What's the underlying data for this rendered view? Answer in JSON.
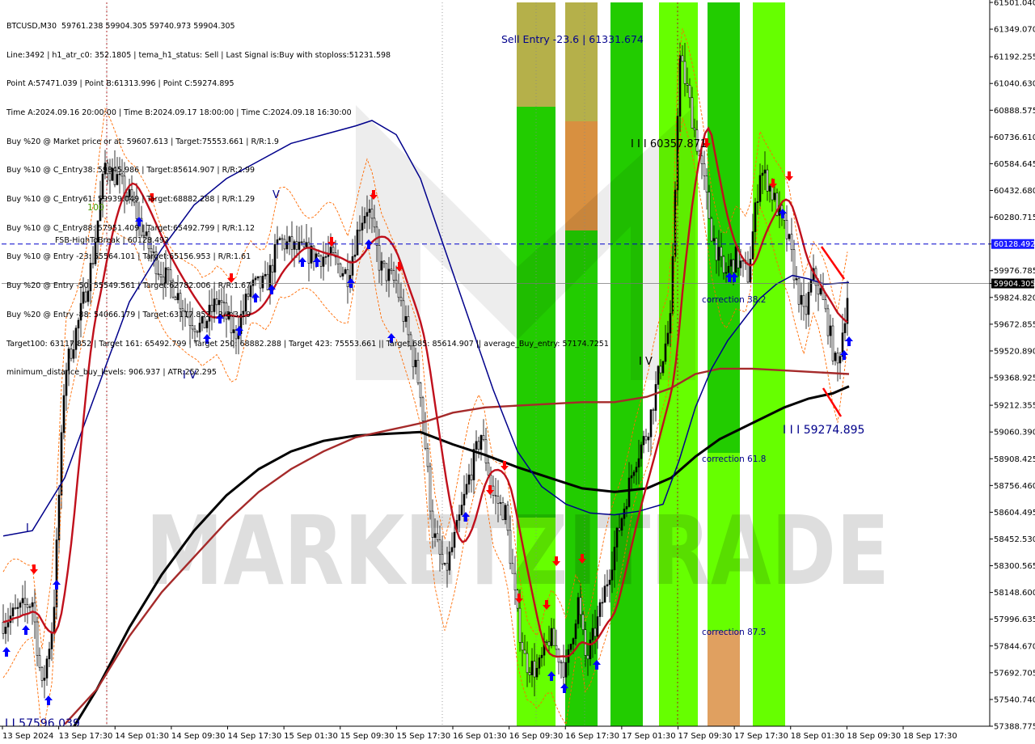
{
  "header": {
    "lines": [
      "BTCUSD,M30  59761.238 59904.305 59740.973 59904.305",
      "Line:3492 | h1_atr_c0: 352.1805 | tema_h1_status: Sell | Last Signal is:Buy with stoploss:51231.598",
      "Point A:57471.039 | Point B:61313.996 | Point C:59274.895",
      "Time A:2024.09.16 20:00:00 | Time B:2024.09.17 18:00:00 | Time C:2024.09.18 16:30:00",
      "Buy %20 @ Market price or at: 59607.613 | Target:75553.661 | R/R:1.9",
      "Buy %10 @ C_Entry38: 59845.986 | Target:85614.907 | R/R:2.99",
      "Buy %10 @ C_Entry61: 59939.049 | Target:68882.288 | R/R:1.29",
      "Buy %10 @ C_Entry88: 57951.409 | Target:65492.799 | R/R:1.12",
      "Buy %10 @ Entry -23: 55564.101 | Target:65156.953 | R/R:1.61",
      "Buy %20 @ Entry -50: 55549.561 | Target:62782.006 | R/R:1.67",
      "Buy %20 @ Entry -88: 54066.179 | Target:63117.852 | R/R:3.19",
      "Target100: 63117.852 | Target 161: 65492.799 | Target 250: 68882.288 | Target 423: 75553.661 || Target 685: 85614.907 || average_Buy_entry: 57174.7251",
      "minimum_distance_buy_levels: 906.937 | ATR:252.295"
    ]
  },
  "labels": {
    "sell_entry": "Sell Entry -23.6 | 61331.674",
    "point_b": "I I I 60357.871",
    "point_c": "I I I 59274.895",
    "point_a": "I I 57596.039",
    "fsb": "FSB-HighToBreak | 60128.492",
    "corr38": "correction 38.2",
    "corr61": "correction 61.8",
    "corr87": "correction 87.5",
    "wave_v": "V",
    "wave_iv1": "I V",
    "wave_iv2": "I V",
    "wave_i": "I",
    "hundred": "100",
    "watermark": "MARKETZITRADE"
  },
  "price_boxes": {
    "fsb_price": "60128.492",
    "current_price": "59904.305"
  },
  "colors": {
    "navy_ma": "#00008b",
    "red_ma": "#c0101c",
    "darkred_ma": "#a52a2a",
    "black_ma": "#000000",
    "green_zone": "#22cc00",
    "lime_zone": "#66ff00",
    "olive_zone": "#b5b04a",
    "orange_zone": "#e0a060",
    "buy_arrow": "#0000ff",
    "sell_arrow": "#ff0000",
    "fsb_line": "#0000cc"
  },
  "chart_data": {
    "type": "candlestick",
    "symbol": "BTCUSD",
    "timeframe": "M30",
    "ylim": [
      57388.775,
      61501.04
    ],
    "y_ticks": [
      "61501.040",
      "61349.070",
      "61192.255",
      "61040.630",
      "60888.575",
      "60736.610",
      "60584.645",
      "60432.680",
      "60280.715",
      "60128.492",
      "59976.785",
      "59904.305",
      "59824.820",
      "59672.855",
      "59520.890",
      "59368.925",
      "59212.355",
      "59060.390",
      "58908.425",
      "58756.460",
      "58604.495",
      "58452.530",
      "58300.565",
      "58148.600",
      "57996.635",
      "57844.670",
      "57692.705",
      "57540.740",
      "57388.775"
    ],
    "x_ticks": [
      "13 Sep 2024",
      "13 Sep 17:30",
      "14 Sep 01:30",
      "14 Sep 09:30",
      "14 Sep 17:30",
      "15 Sep 01:30",
      "15 Sep 09:30",
      "15 Sep 17:30",
      "16 Sep 01:30",
      "16 Sep 09:30",
      "16 Sep 17:30",
      "17 Sep 01:30",
      "17 Sep 09:30",
      "17 Sep 17:30",
      "18 Sep 01:30",
      "18 Sep 09:30",
      "18 Sep 17:30"
    ],
    "levels": {
      "fsb_high_to_break": 60128.492,
      "current_price": 59904.305
    },
    "points": {
      "A": 57471.039,
      "B": 61313.996,
      "C": 59274.895
    }
  }
}
